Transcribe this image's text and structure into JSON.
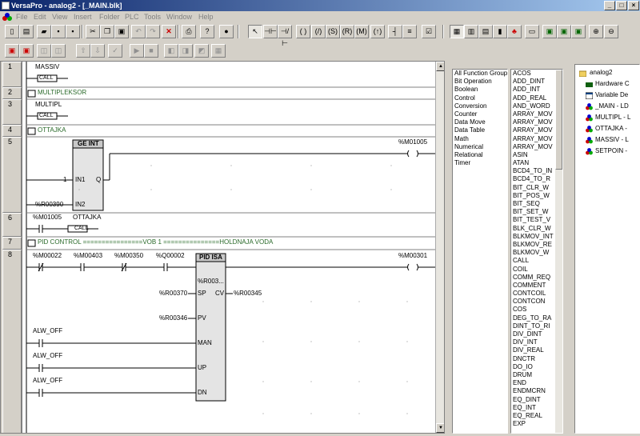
{
  "window": {
    "title": "VersaPro - analog2 - [_MAIN.blk]"
  },
  "menu": [
    "File",
    "Edit",
    "View",
    "Insert",
    "Folder",
    "PLC",
    "Tools",
    "Window",
    "Help"
  ],
  "toolbar": {
    "row1": [
      "new-icon",
      "open-icon",
      "save-icon",
      "save-all-icon",
      "cut-icon",
      "copy-icon",
      "paste-icon",
      "undo-icon",
      "redo-icon",
      "delete-icon",
      "print-icon",
      "context-help-icon",
      "info-icon",
      "select-icon",
      "contact-no-icon",
      "contact-nc-icon",
      "coil-icon",
      "coil-negated-icon",
      "coil-set-icon",
      "coil-reset-icon",
      "coil-retentive-icon",
      "vertical-link-icon",
      "horizontal-link-icon",
      "properties-icon",
      "toolchest-icon",
      "tile-icon",
      "mdi-icon",
      "bars-icon",
      "variables-icon",
      "fold-icon",
      "unfold-icon",
      "zoom-in-icon",
      "zoom-out-icon"
    ],
    "row2": [
      "online-icon",
      "offline-icon",
      "icon3",
      "icon4",
      "icon5",
      "icon6",
      "run-icon",
      "stop-icon",
      "icon9",
      "icon10",
      "icon11",
      "icon12"
    ]
  },
  "rungs": [
    {
      "num": "1",
      "label": "MASSIV",
      "element": "CALL"
    },
    {
      "num": "2",
      "comment": "MULTIPLEKSOR"
    },
    {
      "num": "3",
      "label": "MULTIPL",
      "element": "CALL"
    },
    {
      "num": "4",
      "comment": "OTTAJKA"
    },
    {
      "num": "5",
      "block": "GE INT",
      "in1_const": "1",
      "in1": "IN1",
      "in2": "IN2",
      "q": "Q",
      "in2_var": "%R00390",
      "coil": "%M01005"
    },
    {
      "num": "6",
      "contact": "%M01005",
      "label": "OTTAJKA",
      "element": "CALL"
    },
    {
      "num": "7",
      "comment": "PID CONTROL ================VOB 1 ===============HOLDNAJA VODA"
    },
    {
      "num": "8",
      "contacts": [
        "%M00022",
        "%M00403",
        "%M00350",
        "%Q00002"
      ],
      "block": "PID ISA",
      "ref": "%R003...",
      "sp": "SP",
      "cv": "CV",
      "pv": "PV",
      "man": "MAN",
      "up": "UP",
      "dn": "DN",
      "sp_var": "%R00370",
      "cv_var": "%R00345",
      "pv_var": "%R00346",
      "alw": [
        "ALW_OFF",
        "ALW_OFF",
        "ALW_OFF"
      ],
      "coil": "%M00301"
    }
  ],
  "function_groups": [
    "All Function Groups",
    "Bit Operation",
    "Boolean",
    "Control",
    "Conversion",
    "Counter",
    "Data Move",
    "Data Table",
    "Math",
    "Numerical",
    "Relational",
    "Timer"
  ],
  "functions": [
    "ACOS",
    "ADD_DINT",
    "ADD_INT",
    "ADD_REAL",
    "AND_WORD",
    "ARRAY_MOV",
    "ARRAY_MOV",
    "ARRAY_MOV",
    "ARRAY_MOV",
    "ARRAY_MOV",
    "ASIN",
    "ATAN",
    "BCD4_TO_IN",
    "BCD4_TO_R",
    "BIT_CLR_W",
    "BIT_POS_W",
    "BIT_SEQ",
    "BIT_SET_W",
    "BIT_TEST_V",
    "BLK_CLR_W",
    "BLKMOV_INT",
    "BLKMOV_RE",
    "BLKMOV_W",
    "CALL",
    "COIL",
    "COMM_REQ",
    "COMMENT",
    "CONTCOIL",
    "CONTCON",
    "COS",
    "DEG_TO_RA",
    "DINT_TO_RI",
    "DIV_DINT",
    "DIV_INT",
    "DIV_REAL",
    "DNCTR",
    "DO_IO",
    "DRUM",
    "END",
    "ENDMCRN",
    "EQ_DINT",
    "EQ_INT",
    "EQ_REAL",
    "EXP"
  ],
  "project_tree": {
    "root": "analog2",
    "items": [
      "Hardware C",
      "Variable De",
      "_MAIN - LD",
      "MULTIPL - L",
      "OTTAJKA -",
      "MASSIV - L",
      "SETPOIN -"
    ]
  }
}
